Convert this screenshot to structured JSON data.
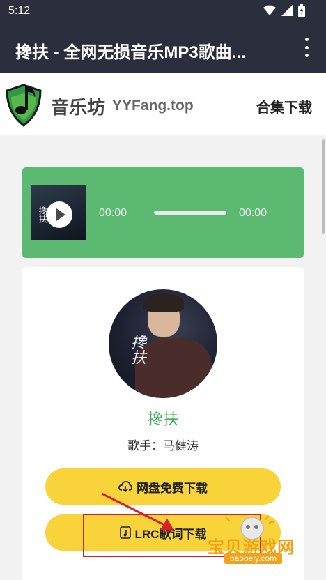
{
  "status_bar": {
    "time": "5:12",
    "wifi_icon": "wifi-icon",
    "signal_icon": "signal-icon",
    "battery_icon": "battery-icon"
  },
  "app_bar": {
    "title": "搀扶 - 全网无损音乐MP3歌曲...",
    "menu_icon": "more-vert-icon"
  },
  "site": {
    "name": "音乐坊",
    "domain": "YYFang.top",
    "collection_link": "合集下载",
    "logo_icon": "music-note-shield-logo"
  },
  "player": {
    "current_time": "00:00",
    "duration": "00:00",
    "progress": 0,
    "cover_text": "搀扶"
  },
  "song": {
    "cover_text": "搀扶",
    "title": "搀扶",
    "artist_label": "歌手：马健涛"
  },
  "buttons": {
    "cloud_download": "网盘免费下载",
    "lrc_download": "LRC歌词下载"
  },
  "watermark": {
    "text": "宝贝游戏网",
    "url": "baobeiy.com"
  },
  "colors": {
    "appbar": "#2b2e3c",
    "player_bg": "#5cb971",
    "title_green": "#3fae5a",
    "button_yellow": "#f8d33a",
    "annotation_red": "#d8202c"
  }
}
